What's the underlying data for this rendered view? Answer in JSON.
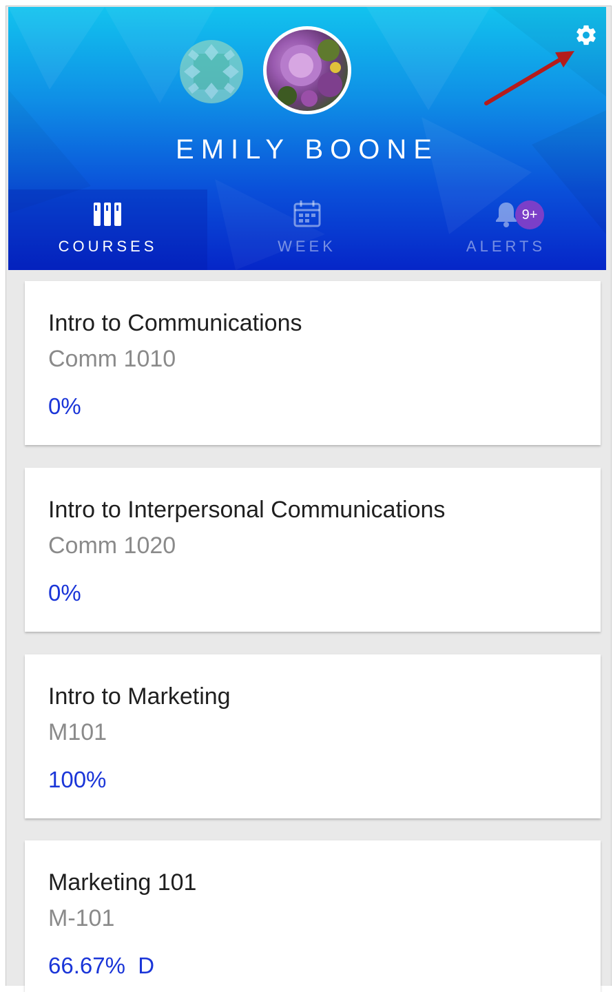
{
  "profile": {
    "name": "EMILY BOONE",
    "settings_icon": "gear-icon"
  },
  "tabs": [
    {
      "label": "COURSES",
      "icon": "courses-icon",
      "active": true
    },
    {
      "label": "WEEK",
      "icon": "calendar-icon",
      "active": false
    },
    {
      "label": "ALERTS",
      "icon": "bell-icon",
      "active": false,
      "badge": "9+"
    }
  ],
  "courses": [
    {
      "name": "Intro to Communications",
      "code": "Comm 1010",
      "grade": "0%"
    },
    {
      "name": "Intro to Interpersonal Communications",
      "code": "Comm 1020",
      "grade": "0%"
    },
    {
      "name": "Intro to Marketing",
      "code": "M101",
      "grade": "100%"
    },
    {
      "name": "Marketing 101",
      "code": "M-101",
      "grade": "66.67%  D"
    }
  ],
  "colors": {
    "header_top": "#12c3ee",
    "header_bottom": "#0626c8",
    "grade_text": "#1a35d8",
    "badge": "#7b3fc8",
    "annotation_arrow": "#b51c1c"
  }
}
